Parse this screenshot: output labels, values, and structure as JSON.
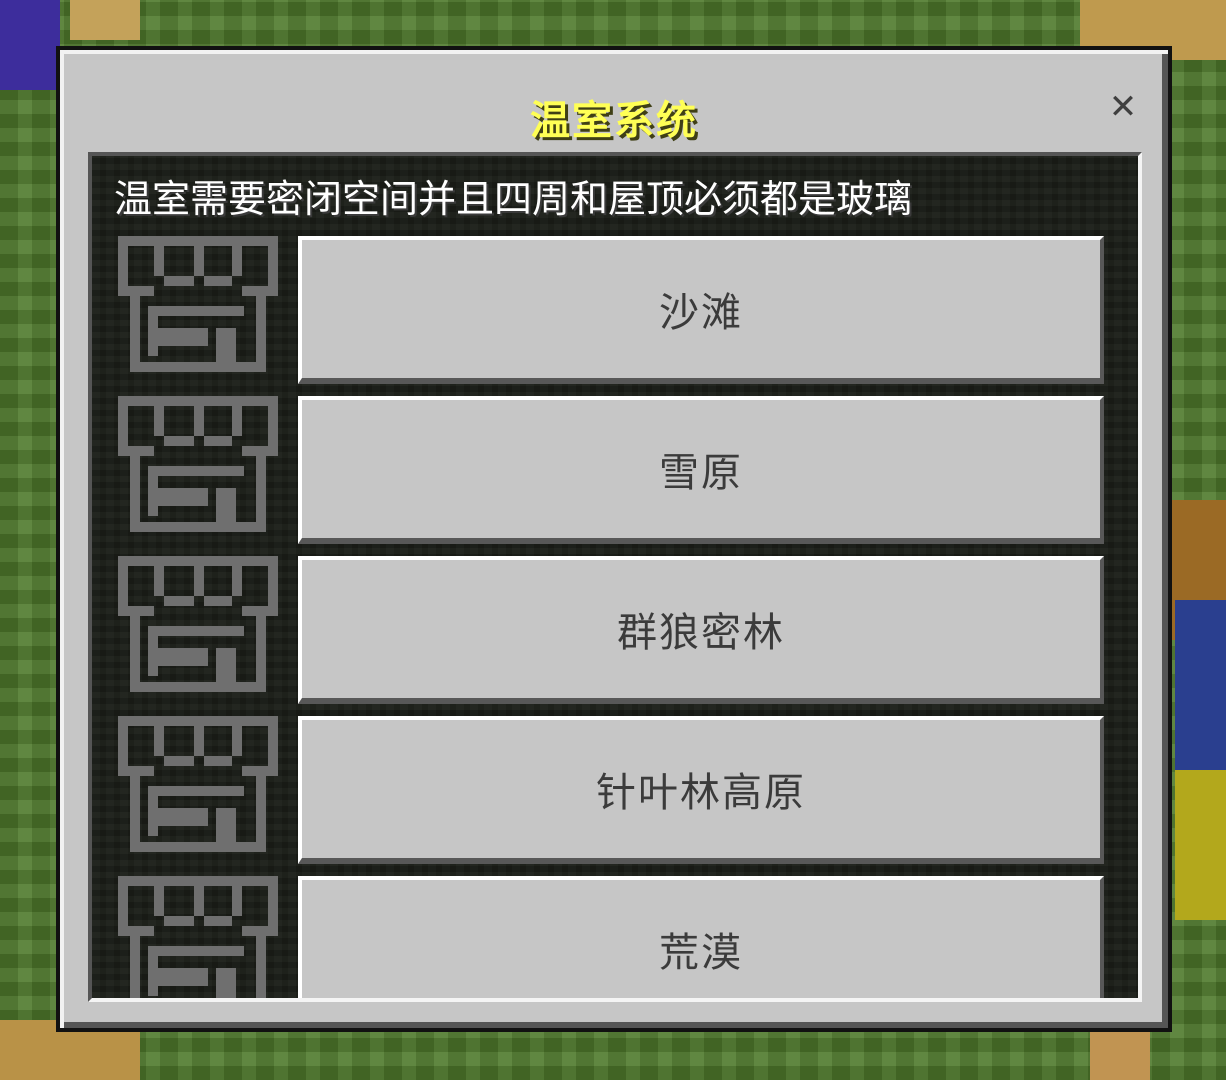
{
  "dialog": {
    "title": "温室系统",
    "close_label": "✕",
    "description": "温室需要密闭空间并且四周和屋顶必须都是玻璃",
    "options": [
      {
        "label": "沙滩",
        "icon": "greenhouse-icon"
      },
      {
        "label": "雪原",
        "icon": "greenhouse-icon"
      },
      {
        "label": "群狼密林",
        "icon": "greenhouse-icon"
      },
      {
        "label": "针叶林高原",
        "icon": "greenhouse-icon"
      },
      {
        "label": "荒漠",
        "icon": "greenhouse-icon"
      }
    ]
  },
  "colors": {
    "title": "#ffff55",
    "dialog_bg": "#c6c6c6",
    "panel_bg": "#1a1d17",
    "button_bg": "#c6c6c6",
    "icon": "#6f6f6f"
  }
}
